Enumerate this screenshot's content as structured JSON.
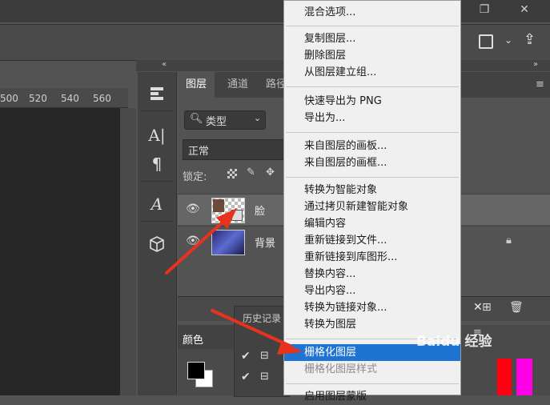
{
  "ruler_ticks": [
    "500",
    "520",
    "540",
    "560"
  ],
  "panel_tabs": [
    "图层",
    "通道",
    "路径"
  ],
  "filter_label": "类型",
  "blend_mode": "正常",
  "lock_label": "锁定:",
  "layers": [
    {
      "name": "脸",
      "selected": true
    },
    {
      "name": "背景",
      "selected": false
    }
  ],
  "color_tab": "颜色",
  "history_tab": "历史记录",
  "context_menu": {
    "items": [
      {
        "label": "混合选项...",
        "state": "normal"
      },
      {
        "label": "复制图层...",
        "state": "normal"
      },
      {
        "label": "删除图层",
        "state": "normal"
      },
      {
        "label": "从图层建立组...",
        "state": "normal"
      },
      {
        "label": "快速导出为 PNG",
        "state": "normal"
      },
      {
        "label": "导出为...",
        "state": "normal"
      },
      {
        "label": "来自图层的画板...",
        "state": "normal"
      },
      {
        "label": "来自图层的画框...",
        "state": "normal"
      },
      {
        "label": "转换为智能对象",
        "state": "normal"
      },
      {
        "label": "通过拷贝新建智能对象",
        "state": "normal"
      },
      {
        "label": "编辑内容",
        "state": "normal"
      },
      {
        "label": "重新链接到文件...",
        "state": "normal"
      },
      {
        "label": "重新链接到库图形...",
        "state": "normal"
      },
      {
        "label": "替换内容...",
        "state": "normal"
      },
      {
        "label": "导出内容...",
        "state": "normal"
      },
      {
        "label": "转换为链接对象...",
        "state": "normal"
      },
      {
        "label": "转换为图层",
        "state": "normal"
      },
      {
        "label": "栅格化图层",
        "state": "highlighted"
      },
      {
        "label": "栅格化图层样式",
        "state": "disabled"
      },
      {
        "label": "启用图层蒙版",
        "state": "normal"
      }
    ]
  },
  "watermark": "Baidu 经验",
  "colors": {
    "menu_highlight": "#1f73d1",
    "annotation_arrow": "#e8321e",
    "panel_bg": "#535353",
    "canvas_bg": "#262626"
  }
}
